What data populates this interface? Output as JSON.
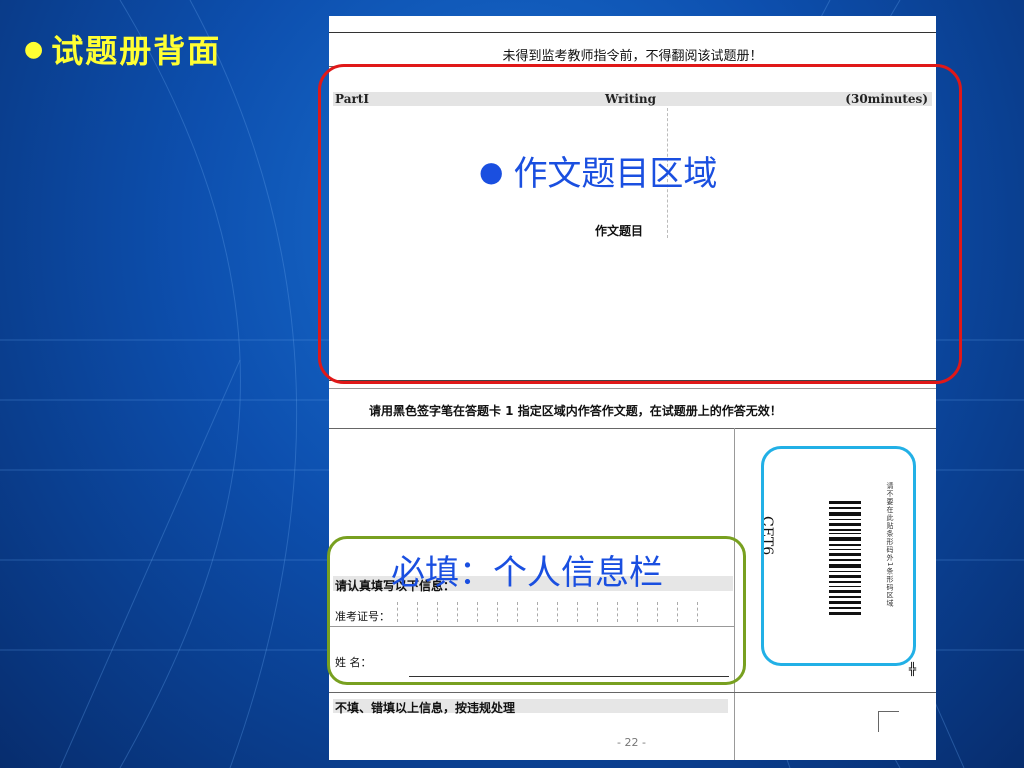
{
  "slide": {
    "title": "试题册背面",
    "bullet": "●"
  },
  "document": {
    "notice": "未得到监考教师指令前，不得翻阅该试题册！",
    "part": {
      "left": "PartI",
      "middle": "Writing",
      "right": "(30minutes)"
    },
    "essay_title": "作文题目",
    "sign_note": "请用黑色签字笔在答题卡 1 指定区域内作答作文题，在试题册上的作答无效！",
    "info_label": "请认真填写以下信息：",
    "exam_id_label": "准考证号：",
    "name_label": "姓    名：",
    "warning_label": "不填、错填以上信息，按违规处理",
    "page_number": "- 22 -",
    "barcode_text": "CET6",
    "barcode_side_text": "请不要在此贴条形码外1条形码区域"
  },
  "annotations": {
    "writing_area": "作文题目区域",
    "writing_bullet": "●",
    "info_area": "必填：个人信息栏"
  },
  "colors": {
    "title_yellow": "#ffff33",
    "annotation_blue": "#1a4fe0",
    "red_box": "#e01818",
    "green_box": "#78a020",
    "cyan_box": "#22b0e6"
  }
}
